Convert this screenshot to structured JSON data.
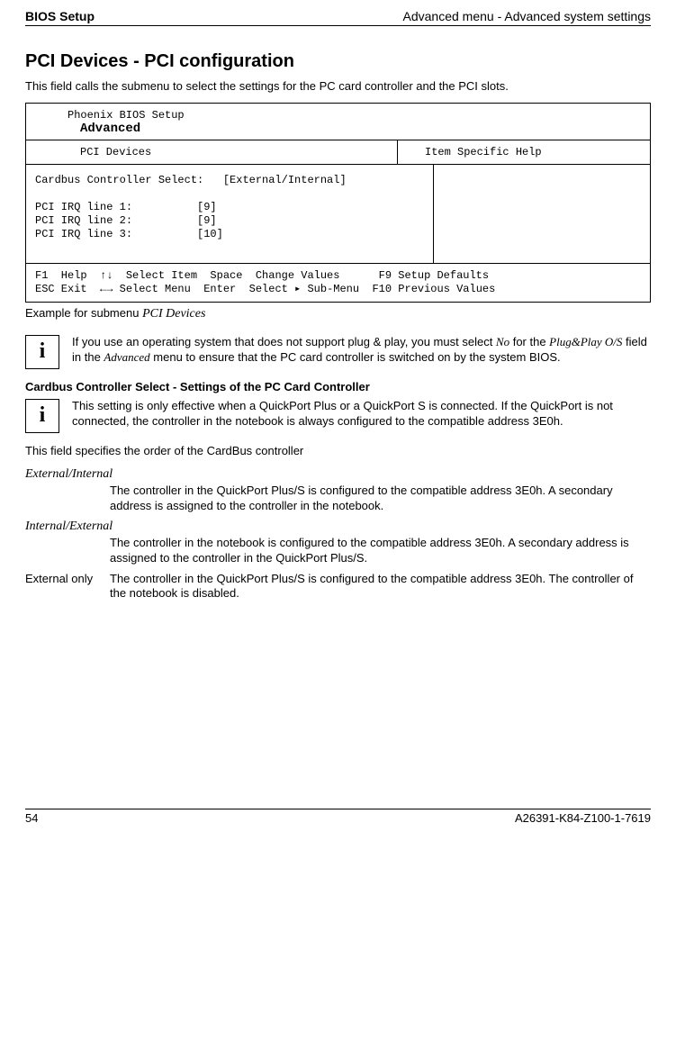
{
  "header": {
    "left": "BIOS Setup",
    "right": "Advanced menu - Advanced system settings"
  },
  "title": "PCI Devices - PCI configuration",
  "intro": "This field calls the submenu to select the settings for the PC card controller and the PCI slots.",
  "bios": {
    "setup_line": "Phoenix BIOS Setup",
    "menu": "Advanced",
    "left_head": "PCI Devices",
    "right_head": "Item Specific Help",
    "body": "Cardbus Controller Select:   [External/Internal]\n\nPCI IRQ line 1:          [9]\nPCI IRQ line 2:          [9]\nPCI IRQ line 3:          [10]",
    "footer": "F1  Help  ↑↓  Select Item  Space  Change Values      F9 Setup Defaults\nESC Exit  ←→ Select Menu  Enter  Select ▸ Sub-Menu  F10 Previous Values"
  },
  "caption": {
    "lead": "Example for submenu ",
    "ital": "PCI Devices"
  },
  "info1": {
    "p1a": "If you use an operating system that does not support plug & play, you must select ",
    "p1b": "No",
    "p1c": " for the ",
    "p1d": "Plug&Play O/S",
    "p1e": " field in the ",
    "p1f": "Advanced",
    "p1g": " menu to ensure that the PC card controller is switched on by the system BIOS."
  },
  "sub1": "Cardbus Controller Select - Settings of the PC Card Controller",
  "info2": "This setting is only effective when a QuickPort Plus or a QuickPort S is connected. If the QuickPort is not connected, the controller in the notebook is always configured to the compatible address 3E0h.",
  "line_after": "This field specifies the order of the CardBus controller",
  "defs": {
    "t1": "External/Internal",
    "b1": "The controller in the QuickPort Plus/S is configured to the compatible address 3E0h. A secondary address is assigned to the controller in the notebook.",
    "t2": "Internal/External",
    "b2": "The controller in the notebook is configured to the compatible address 3E0h. A secondary address is assigned to the controller in the QuickPort Plus/S.",
    "t3": "External only",
    "b3": "The controller in the QuickPort Plus/S is configured to the compatible address 3E0h. The controller of the notebook is disabled."
  },
  "footer": {
    "page": "54",
    "code": "A26391-K84-Z100-1-7619"
  },
  "icon_letter": "i"
}
